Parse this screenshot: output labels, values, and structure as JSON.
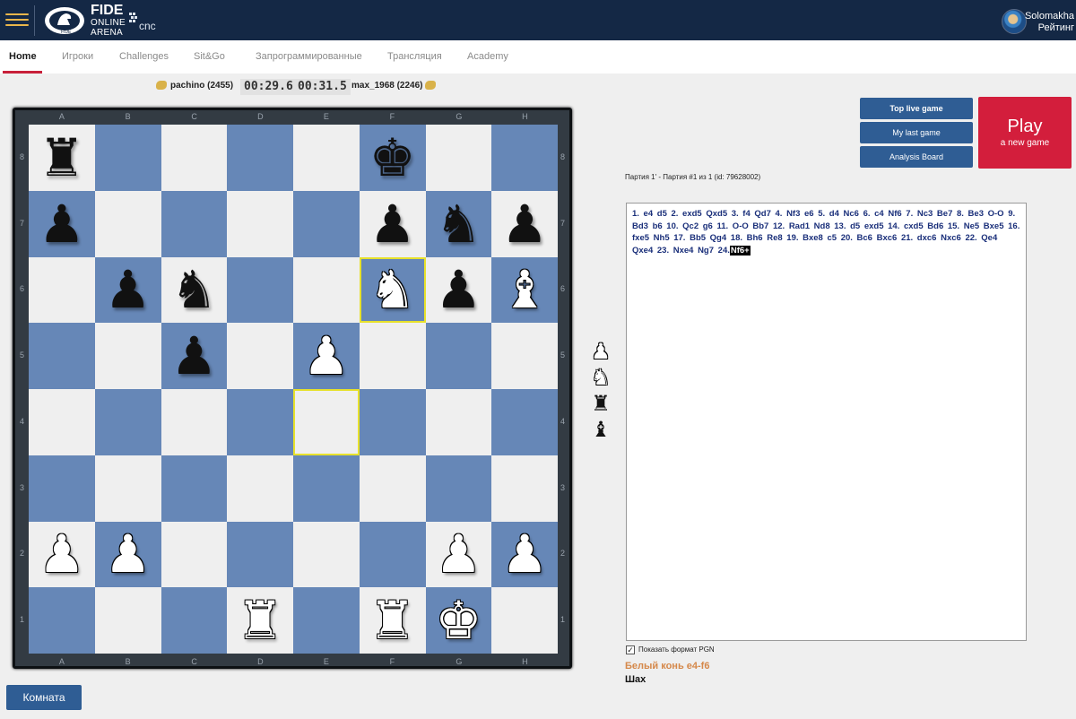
{
  "header": {
    "logo_line1": "FIDE",
    "logo_line2": "ONLINE",
    "logo_line3": "ARENA",
    "partner_logo": "cnc",
    "user_name": "Solomakha",
    "user_rating_label": "Рейтинг",
    "menu_icon": "hamburger-icon",
    "brand_color": "#142845",
    "accent_color": "#e9b64b"
  },
  "nav": {
    "tabs": [
      {
        "label": "Home",
        "active": true
      },
      {
        "label": "Игроки"
      },
      {
        "label": "Challenges"
      },
      {
        "label": "Sit&Go"
      },
      {
        "label": "Запрограммированные"
      },
      {
        "label": "Трансляция"
      },
      {
        "label": "Academy"
      }
    ]
  },
  "players": {
    "top_left": "pachino (2455)",
    "clock_left": "00:29.6",
    "clock_right": "00:31.5",
    "top_right": "max_1968 (2246)"
  },
  "board": {
    "files": [
      "A",
      "B",
      "C",
      "D",
      "E",
      "F",
      "G",
      "H"
    ],
    "ranks": [
      "8",
      "7",
      "6",
      "5",
      "4",
      "3",
      "2",
      "1"
    ],
    "highlight_squares": [
      "f6",
      "e4"
    ],
    "light_color": "#efefef",
    "dark_color": "#6687b7",
    "pieces": [
      {
        "sq": "a8",
        "p": "r",
        "c": "b"
      },
      {
        "sq": "f8",
        "p": "k",
        "c": "b"
      },
      {
        "sq": "a7",
        "p": "p",
        "c": "b"
      },
      {
        "sq": "f7",
        "p": "p",
        "c": "b"
      },
      {
        "sq": "g7",
        "p": "n",
        "c": "b"
      },
      {
        "sq": "h7",
        "p": "p",
        "c": "b"
      },
      {
        "sq": "b6",
        "p": "p",
        "c": "b"
      },
      {
        "sq": "c6",
        "p": "n",
        "c": "b"
      },
      {
        "sq": "f6",
        "p": "n",
        "c": "w"
      },
      {
        "sq": "g6",
        "p": "p",
        "c": "b"
      },
      {
        "sq": "h6",
        "p": "b",
        "c": "w"
      },
      {
        "sq": "c5",
        "p": "p",
        "c": "b"
      },
      {
        "sq": "e5",
        "p": "p",
        "c": "w"
      },
      {
        "sq": "a2",
        "p": "p",
        "c": "w"
      },
      {
        "sq": "b2",
        "p": "p",
        "c": "w"
      },
      {
        "sq": "g2",
        "p": "p",
        "c": "w"
      },
      {
        "sq": "h2",
        "p": "p",
        "c": "w"
      },
      {
        "sq": "d1",
        "p": "r",
        "c": "w"
      },
      {
        "sq": "f1",
        "p": "r",
        "c": "w"
      },
      {
        "sq": "g1",
        "p": "k",
        "c": "w"
      }
    ]
  },
  "captured": [
    {
      "p": "p",
      "c": "w",
      "icon": "white-pawn-icon"
    },
    {
      "p": "n",
      "c": "w",
      "icon": "white-knight-icon"
    },
    {
      "p": "r",
      "c": "b",
      "icon": "black-rook-icon"
    },
    {
      "p": "b",
      "c": "b",
      "icon": "black-bishop-icon"
    }
  ],
  "actions": {
    "top_live_game": "Top live game",
    "my_last_game": "My last game",
    "analysis_board": "Analysis Board",
    "play_title": "Play",
    "play_subtitle": "a new game",
    "room_button": "Комната",
    "play_color": "#d31e3c",
    "button_color": "#2f5d94"
  },
  "game_info": "Партия 1' - Партия #1 из 1 (id: 79628002)",
  "moves": {
    "text_before_current": "1. e4  d5  2. exd5  Qxd5  3. f4  Qd7  4. Nf3  e6  5. d4  Nc6  6. c4  Nf6  7. Nc3  Be7  8. Be3  O-O  9. Bd3  b6  10. Qc2  g6  11. O-O  Bb7  12. Rad1  Nd8  13. d5  exd5  14. cxd5  Bd6  15. Ne5  Bxe5  16. fxe5  Nh5  17. Bb5  Qg4  18. Bh6  Re8  19. Bxe8  c5  20. Bc6  Bxc6  21. dxc6  Nxc6  22. Qe4  Qxe4  23. Nxe4  Ng7  24.",
    "current_move": "Nf6+"
  },
  "pgn_checkbox_label": "Показать формат PGN",
  "status_move": "Белый конь e4-f6",
  "status_check": "Шах"
}
